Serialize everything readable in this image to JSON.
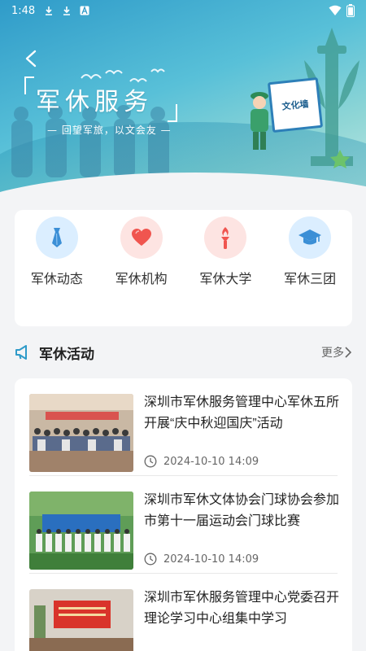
{
  "status_bar": {
    "time": "1:48",
    "icons": [
      "download-icon",
      "download-icon",
      "text-a-icon"
    ],
    "right_icons": [
      "wifi-icon",
      "battery-icon"
    ]
  },
  "banner": {
    "title": "军休服务",
    "subtitle": "— 回望军旅，以文会友 —",
    "sign_text": "文化墙"
  },
  "categories": [
    {
      "label": "军休动态",
      "icon": "tie-icon",
      "color": "#3b8fd6",
      "bg": "#dbeeff"
    },
    {
      "label": "军休机构",
      "icon": "heart-icon",
      "color": "#f0554f",
      "bg": "#fde4e2"
    },
    {
      "label": "军休大学",
      "icon": "torch-icon",
      "color": "#f0554f",
      "bg": "#fde4e2"
    },
    {
      "label": "军休三团",
      "icon": "graduation-cap-icon",
      "color": "#3b8fd6",
      "bg": "#dbeeff"
    }
  ],
  "section": {
    "title": "军休活动",
    "more_label": "更多"
  },
  "news": [
    {
      "title": "深圳市军休服务管理中心军休五所开展“庆中秋迎国庆”活动",
      "time": "2024-10-10 14:09"
    },
    {
      "title": "深圳市军休文体协会门球协会参加市第十一届运动会门球比赛",
      "time": "2024-10-10 14:09"
    },
    {
      "title": "深圳市军休服务管理中心党委召开理论学习中心组集中学习",
      "time": ""
    }
  ],
  "colors": {
    "accent": "#2f9bc9",
    "text": "#222222",
    "muted": "#666666"
  }
}
